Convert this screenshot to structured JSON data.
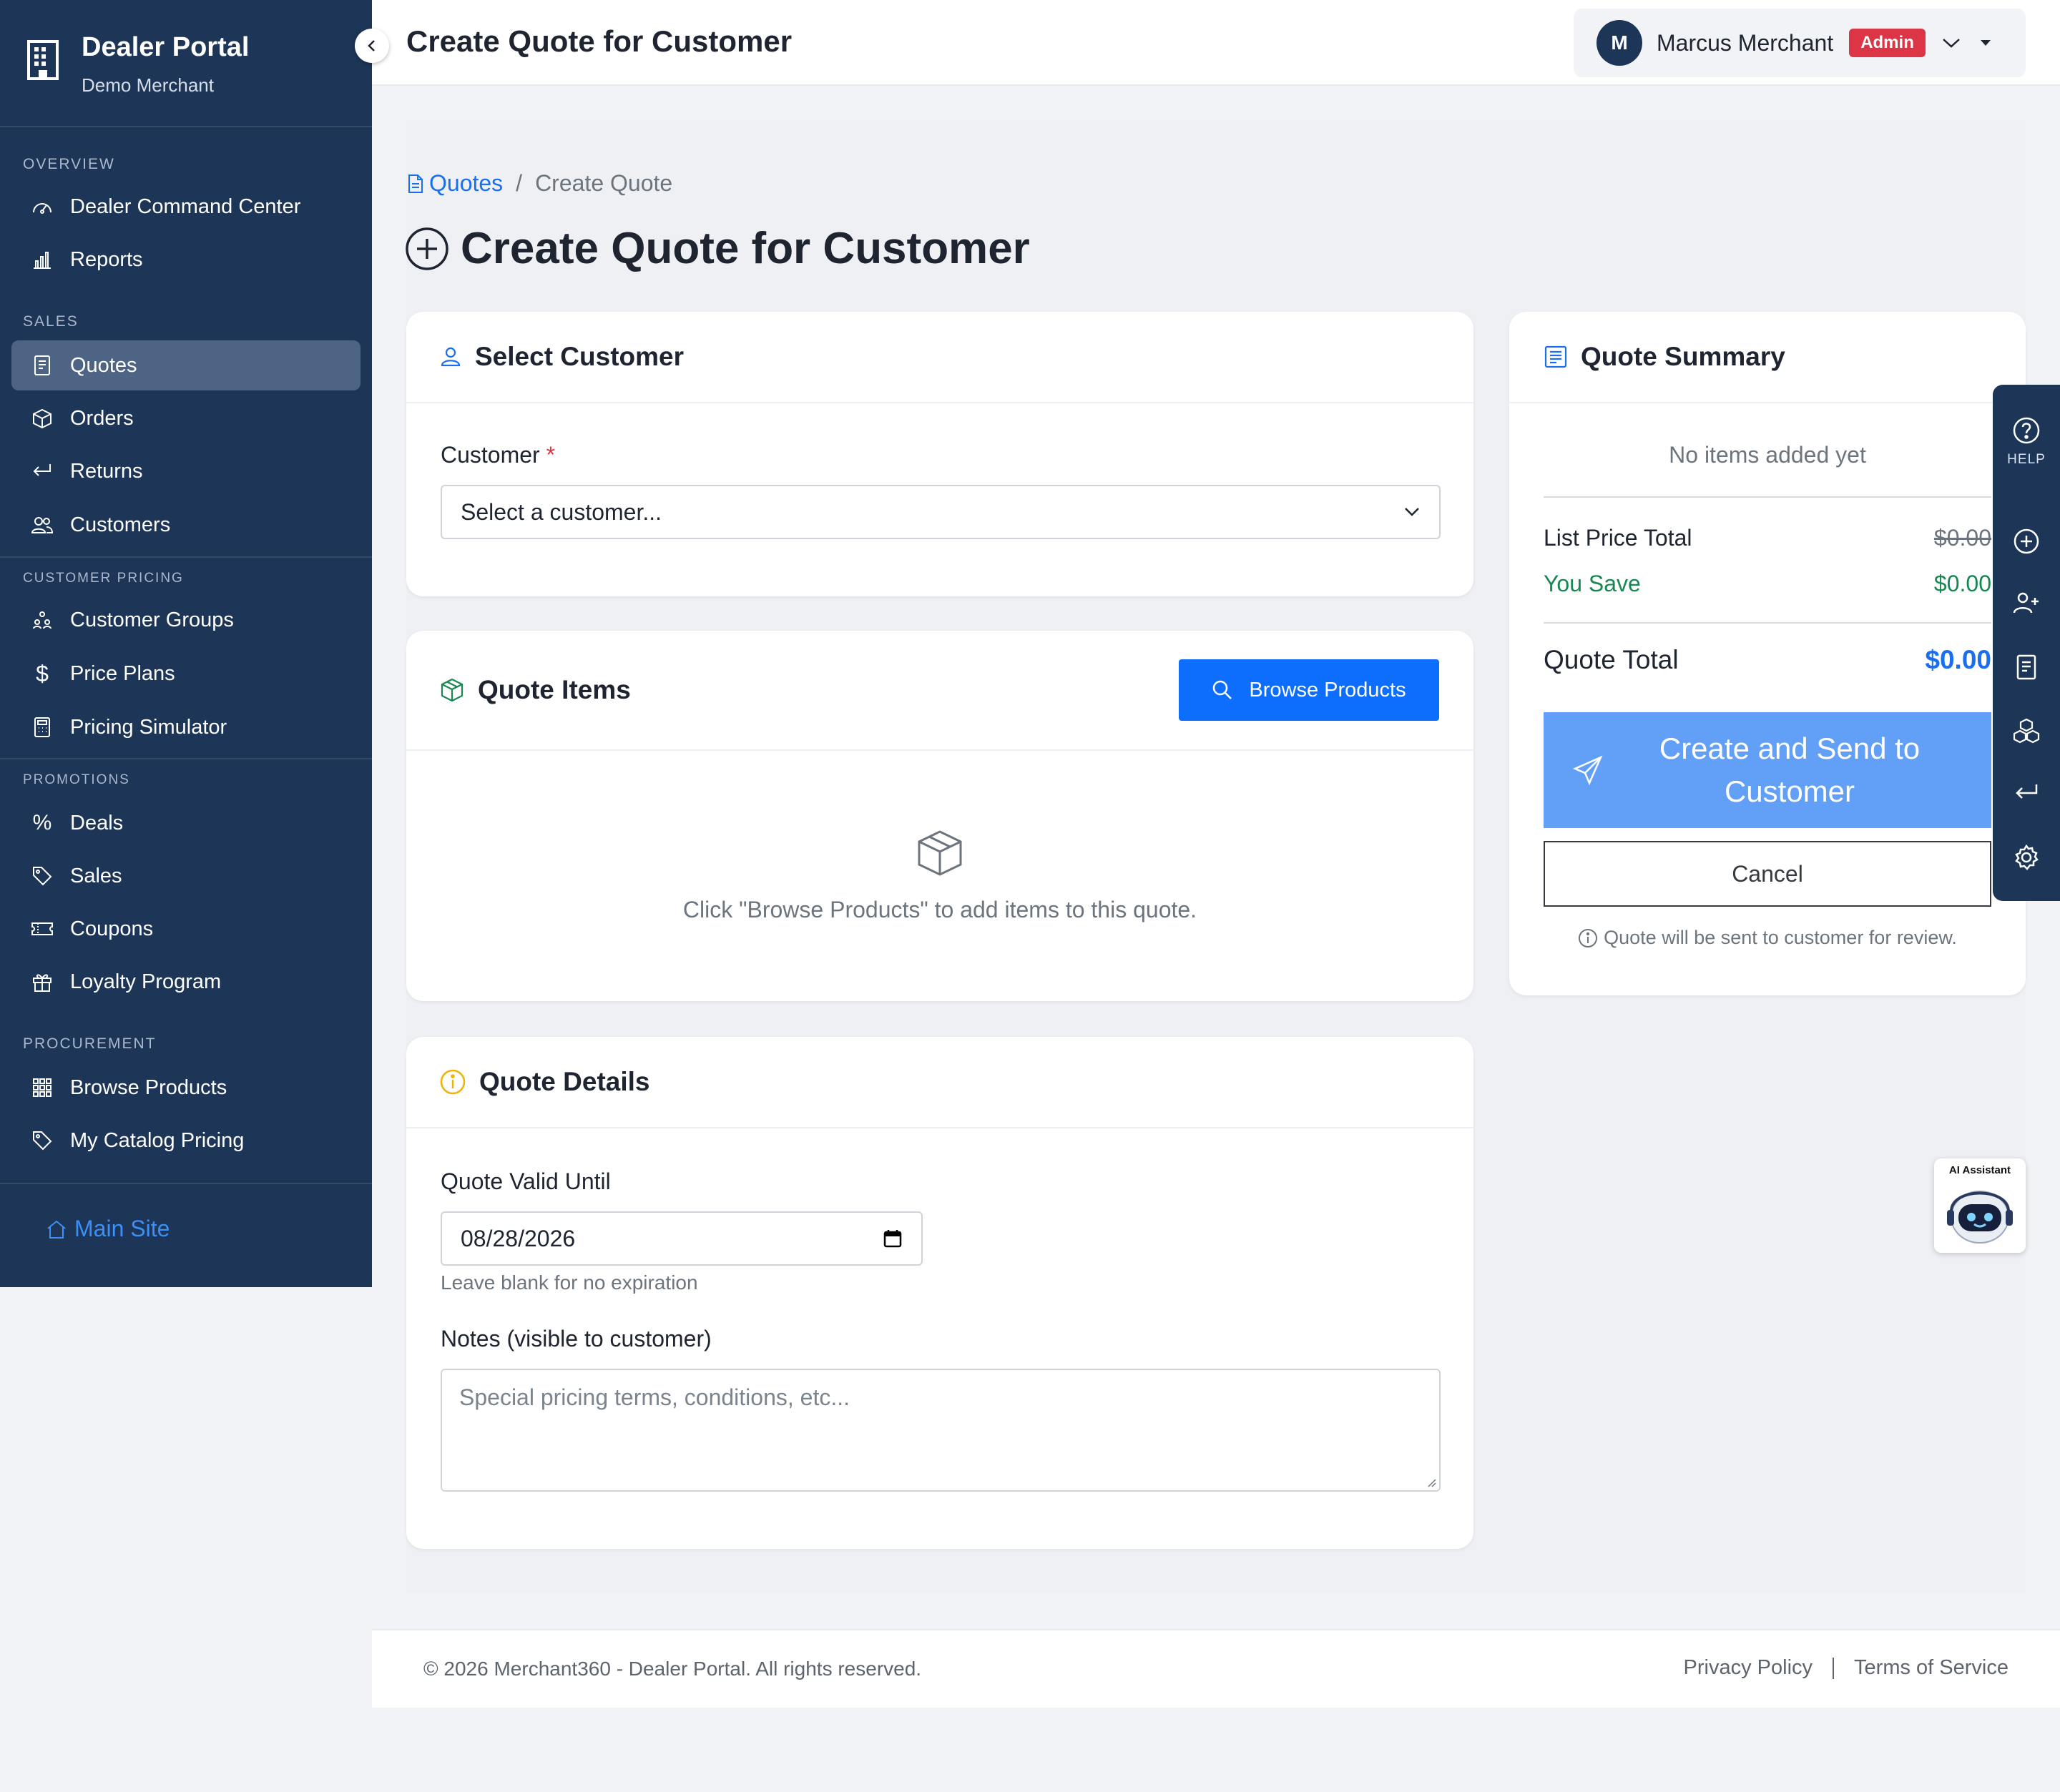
{
  "sidebar": {
    "brand_title": "Dealer Portal",
    "brand_subtitle": "Demo Merchant",
    "sections": {
      "overview": "OVERVIEW",
      "sales": "SALES",
      "customer_pricing": "CUSTOMER PRICING",
      "promotions": "PROMOTIONS",
      "procurement": "PROCUREMENT"
    },
    "items": {
      "command_center": "Dealer Command Center",
      "reports": "Reports",
      "quotes": "Quotes",
      "orders": "Orders",
      "returns": "Returns",
      "customers": "Customers",
      "customer_groups": "Customer Groups",
      "price_plans": "Price Plans",
      "pricing_simulator": "Pricing Simulator",
      "deals": "Deals",
      "sales": "Sales",
      "coupons": "Coupons",
      "loyalty_program": "Loyalty Program",
      "browse_products": "Browse Products",
      "my_catalog_pricing": "My Catalog Pricing"
    },
    "active_item": "Quotes",
    "main_site": "Main Site"
  },
  "header": {
    "title": "Create Quote for Customer",
    "user_initial": "M",
    "user_name": "Marcus Merchant",
    "role_badge": "Admin"
  },
  "breadcrumb": {
    "parent": "Quotes",
    "separator": "/",
    "current": "Create Quote"
  },
  "page_title": "Create Quote for Customer",
  "select_customer": {
    "heading": "Select Customer",
    "label": "Customer",
    "required_mark": "*",
    "selected_value": "Select a customer..."
  },
  "quote_items": {
    "heading": "Quote Items",
    "browse_button": "Browse Products",
    "empty_message": "Click \"Browse Products\" to add items to this quote."
  },
  "quote_details": {
    "heading": "Quote Details",
    "valid_until_label": "Quote Valid Until",
    "valid_until_value": "08/28/2026",
    "valid_until_hint": "Leave blank for no expiration",
    "notes_label": "Notes (visible to customer)",
    "notes_placeholder": "Special pricing terms, conditions, etc..."
  },
  "summary": {
    "heading": "Quote Summary",
    "empty": "No items added yet",
    "list_price_label": "List Price Total",
    "list_price_value": "$0.00",
    "you_save_label": "You Save",
    "you_save_value": "$0.00",
    "total_label": "Quote Total",
    "total_value": "$0.00",
    "create_button": "Create and Send to Customer",
    "cancel_button": "Cancel",
    "note": "Quote will be sent to customer for review."
  },
  "rail": {
    "help_label": "HELP"
  },
  "ai_assistant": {
    "label": "AI Assistant"
  },
  "footer": {
    "copyright": "© 2026 Merchant360 - Dealer Portal. All rights reserved.",
    "privacy": "Privacy Policy",
    "terms": "Terms of Service"
  },
  "colors": {
    "sidebar_bg": "#1d3557",
    "active_nav": "#4e6485",
    "primary": "#0d6efd",
    "create_button": "#62a0f8",
    "danger": "#dc3545",
    "success": "#198754"
  }
}
